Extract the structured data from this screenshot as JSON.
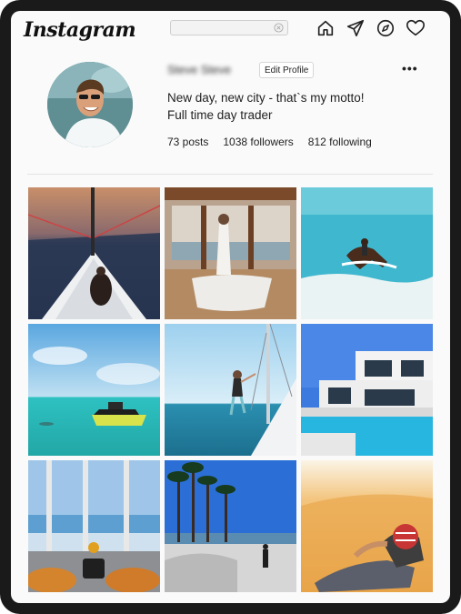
{
  "app": {
    "logo_text": "Instagram"
  },
  "search": {
    "placeholder": ""
  },
  "nav": {
    "icons": [
      "home-icon",
      "send-icon",
      "explore-icon",
      "heart-icon"
    ]
  },
  "profile": {
    "username": "Steve Steve",
    "edit_label": "Edit Profile",
    "more_label": "•••",
    "bio_line1": "New day, new city - that`s my motto!",
    "bio_line2": "Full time day trader",
    "posts": "73 posts",
    "followers": "1038 followers",
    "following": "812 following"
  },
  "posts": [
    "sailboat-bow-post",
    "bathtub-sea-view-post",
    "horse-riding-surf-post",
    "jet-ski-post",
    "sailboat-mast-post",
    "villa-pool-post",
    "pizza-terrace-post",
    "palm-beach-skatepark-post",
    "desert-man-post"
  ]
}
